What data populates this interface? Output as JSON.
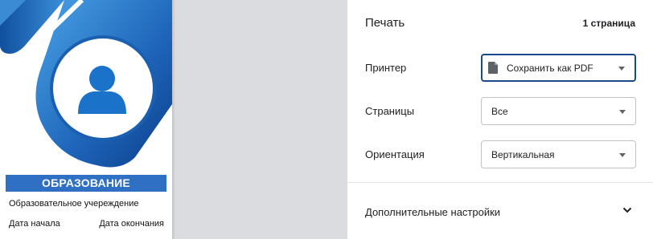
{
  "preview": {
    "section_title": "ОБРАЗОВАНИЕ",
    "institution_label": "Образовательное учереждение",
    "start_date_label": "Дата начала",
    "end_date_label": "Дата окончания",
    "avatar_icon": "person-icon",
    "accent_color": "#2f6fc4"
  },
  "settings": {
    "title": "Печать",
    "page_count": "1 страница",
    "printer": {
      "label": "Принтер",
      "value": "Сохранить как PDF",
      "icon": "pdf-file-icon"
    },
    "pages": {
      "label": "Страницы",
      "value": "Все"
    },
    "orientation": {
      "label": "Ориентация",
      "value": "Вертикальная"
    },
    "more_settings": "Дополнительные настройки",
    "focus_color": "#1a4a8a"
  }
}
